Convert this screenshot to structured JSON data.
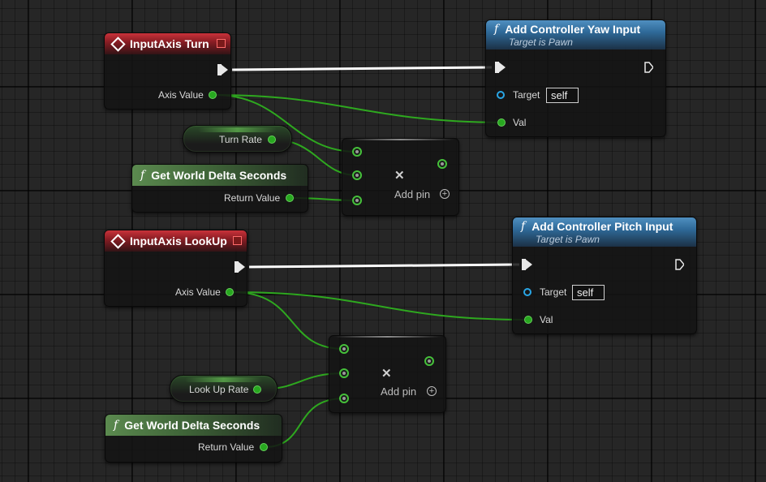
{
  "graph": {
    "colors": {
      "float_wire": "#2ea81f",
      "exec_wire": "#ffffff",
      "event_header": "#b02530",
      "function_header": "#3a7ab0",
      "pure_function_header": "#4f7a46"
    },
    "input_turn": {
      "title": "InputAxis Turn",
      "axis_value_label": "Axis Value"
    },
    "yaw_input": {
      "title": "Add Controller Yaw Input",
      "subtitle": "Target is Pawn",
      "target_label": "Target",
      "target_value": "self",
      "val_label": "Val"
    },
    "turn_rate": {
      "label": "Turn Rate"
    },
    "delta_seconds_1": {
      "title": "Get World Delta Seconds",
      "return_label": "Return Value"
    },
    "multiply_1": {
      "add_pin_label": "Add pin"
    },
    "input_lookup": {
      "title": "InputAxis LookUp",
      "axis_value_label": "Axis Value"
    },
    "pitch_input": {
      "title": "Add Controller Pitch Input",
      "subtitle": "Target is Pawn",
      "target_label": "Target",
      "target_value": "self",
      "val_label": "Val"
    },
    "multiply_2": {
      "add_pin_label": "Add pin"
    },
    "lookup_rate": {
      "label": "Look Up Rate"
    },
    "delta_seconds_2": {
      "title": "Get World Delta Seconds",
      "return_label": "Return Value"
    }
  }
}
